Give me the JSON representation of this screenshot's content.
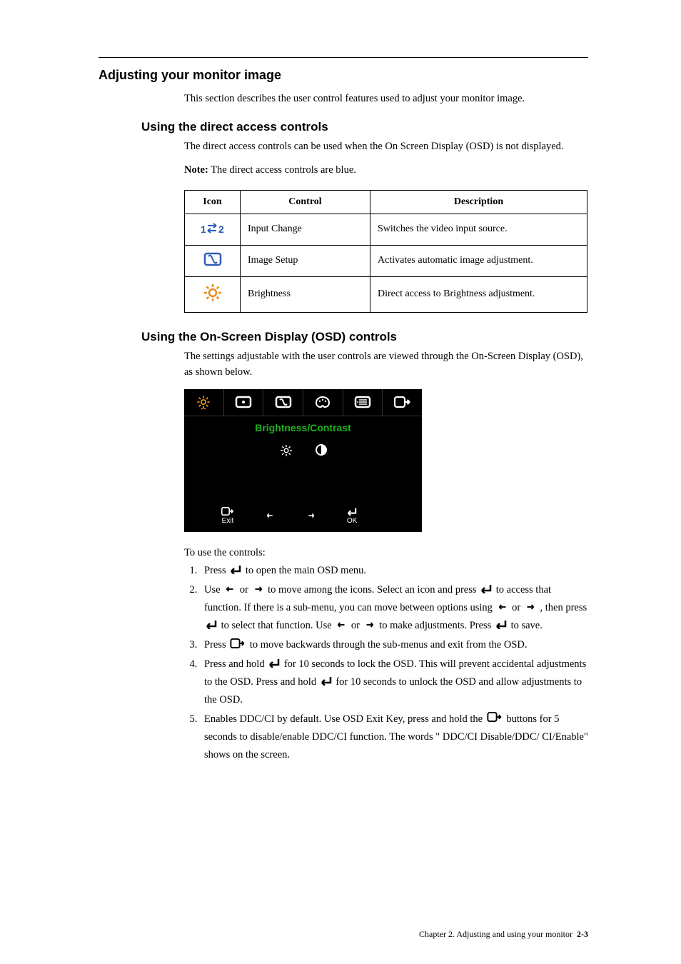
{
  "section_title": "Adjusting your monitor image",
  "intro": "This section describes the user control features used to adjust your monitor image.",
  "sub1_title": "Using the direct access controls",
  "sub1_body": "The direct access controls can be used when the On Screen Display (OSD) is not displayed.",
  "note_label": "Note:",
  "note_body": " The direct access controls are blue.",
  "table": {
    "headers": {
      "icon": "Icon",
      "control": "Control",
      "description": "Description"
    },
    "rows": [
      {
        "control": "Input Change",
        "description": "Switches the video input source."
      },
      {
        "control": "Image Setup",
        "description": "Activates automatic image adjustment."
      },
      {
        "control": "Brightness",
        "description": "Direct access to Brightness adjustment."
      }
    ]
  },
  "sub2_title": "Using the On-Screen Display (OSD) controls",
  "sub2_body": "The settings adjustable with the user controls are viewed through the On-Screen Display (OSD), as shown below.",
  "osd": {
    "title": "Brightness/Contrast",
    "exit_label": "Exit",
    "ok_label": "OK"
  },
  "instructions_lead": "To use the controls:",
  "instructions": {
    "i1a": "Press ",
    "i1b": " to open the main OSD menu.",
    "i2a": "Use ",
    "i2b": " or ",
    "i2c": " to move among the icons. Select an icon and press ",
    "i2d": " to access that function. If there is a sub-menu, you can move between options using ",
    "i2e": " or ",
    "i2f": " , then press ",
    "i2g": " to select that function. Use ",
    "i2h": " or ",
    "i2i": " to make adjustments. Press ",
    "i2j": " to save.",
    "i3a": "Press ",
    "i3b": " to move backwards through the sub-menus and exit from the OSD.",
    "i4a": "Press and hold ",
    "i4b": " for 10 seconds to lock the OSD. This will prevent accidental adjustments to the OSD. Press and hold ",
    "i4c": " for 10 seconds to unlock the OSD and allow adjustments to the OSD.",
    "i5a": "Enables DDC/CI by default. Use OSD Exit Key, press and hold the ",
    "i5b": " buttons for 5 seconds to disable/enable DDC/CI function. The words \" DDC/CI Disable/DDC/ CI/Enable\" shows on the screen."
  },
  "footer_text": "Chapter 2. Adjusting and using your monitor",
  "page_number": "2-3"
}
